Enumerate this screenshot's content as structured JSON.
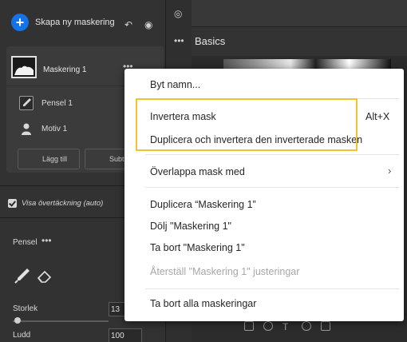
{
  "left_panel": {
    "create_mask_label": "Skapa ny maskering",
    "mask": {
      "label": "Maskering 1"
    },
    "sub_items": [
      {
        "label": "Pensel 1",
        "icon": "brush-icon"
      },
      {
        "label": "Motiv 1",
        "icon": "person-icon"
      }
    ],
    "add_button_label": "Lägg till",
    "subtract_button_label": "Subtrah",
    "show_overlay_label": "Visa övertäckning (auto)",
    "show_overlay_checked": true,
    "brush": {
      "label": "Pensel",
      "size_label": "Storlek",
      "size_value": "13",
      "feather_label": "Ludd",
      "feather_value": "100"
    }
  },
  "right_panel": {
    "header_title": "Basics"
  },
  "context_menu": {
    "items": [
      {
        "label": "Byt namn..."
      },
      {
        "label": "Invertera mask",
        "shortcut": "Alt+X",
        "highlighted": true
      },
      {
        "label": "Duplicera och invertera den inverterade masken",
        "highlighted": true
      },
      {
        "label": "Överlappa mask med",
        "submenu_arrow": "›"
      },
      {
        "label": "Duplicera “Maskering 1”"
      },
      {
        "label": "Dölj \"Maskering 1\""
      },
      {
        "label": "Ta bort \"Maskering 1\""
      },
      {
        "label": "Återställ \"Maskering 1\" justeringar",
        "disabled": true
      },
      {
        "label": "Ta bort alla maskeringar"
      }
    ]
  },
  "colors": {
    "accent": "#1473e6",
    "highlight_border": "#f2c230",
    "menu_bg": "#ffffff",
    "panel_bg": "#323232"
  }
}
